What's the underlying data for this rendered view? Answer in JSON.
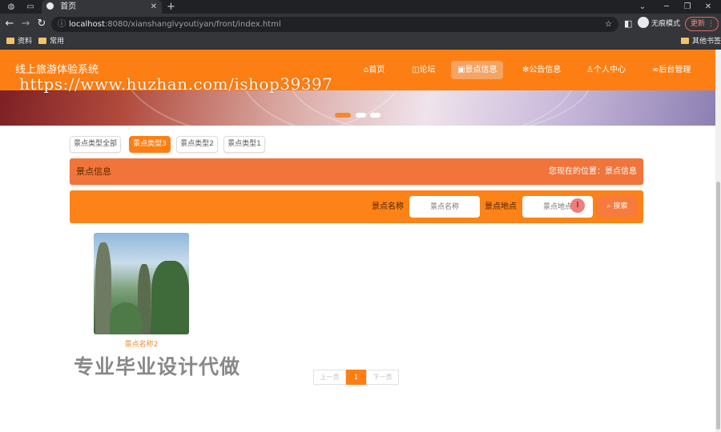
{
  "browser": {
    "tab_title": "首页",
    "url_host": "localhost",
    "url_path": ":8080/xianshanglvyoutiyan/front/index.html",
    "incognito_label": "无痕模式",
    "update_label": "更新",
    "bookmarks": [
      "资料",
      "常用"
    ],
    "other_bookmarks": "其他书签"
  },
  "header": {
    "site_title": "线上旅游体验系统",
    "nav": [
      {
        "icon": "home-icon",
        "label": "首页"
      },
      {
        "icon": "forum-icon",
        "label": "论坛"
      },
      {
        "icon": "image-icon",
        "label": "景点信息"
      },
      {
        "icon": "bell-icon",
        "label": "公告信息"
      },
      {
        "icon": "user-icon",
        "label": "个人中心"
      },
      {
        "icon": "link-icon",
        "label": "后台管理"
      }
    ],
    "active_nav": "景点信息"
  },
  "watermark": {
    "url_text": "https://www.huzhan.com/ishop39397",
    "promo_text": "专业毕业设计代做"
  },
  "categories": [
    "景点类型全部",
    "景点类型3",
    "景点类型2",
    "景点类型1"
  ],
  "active_category": "景点类型3",
  "info_bar": {
    "title": "景点信息",
    "location": "您现在的位置：景点信息"
  },
  "search": {
    "name_label": "景点名称",
    "name_placeholder": "景点名称",
    "place_label": "景点地点",
    "place_placeholder": "景点地点",
    "button_label": "搜索"
  },
  "cards": [
    {
      "caption": "景点名称2"
    }
  ],
  "pagination": {
    "prev": "上一页",
    "current": "1",
    "next": "下一页"
  },
  "colors": {
    "header": "#fd7f14",
    "info_bar": "#f1743a",
    "accent": "#f08a2a"
  }
}
